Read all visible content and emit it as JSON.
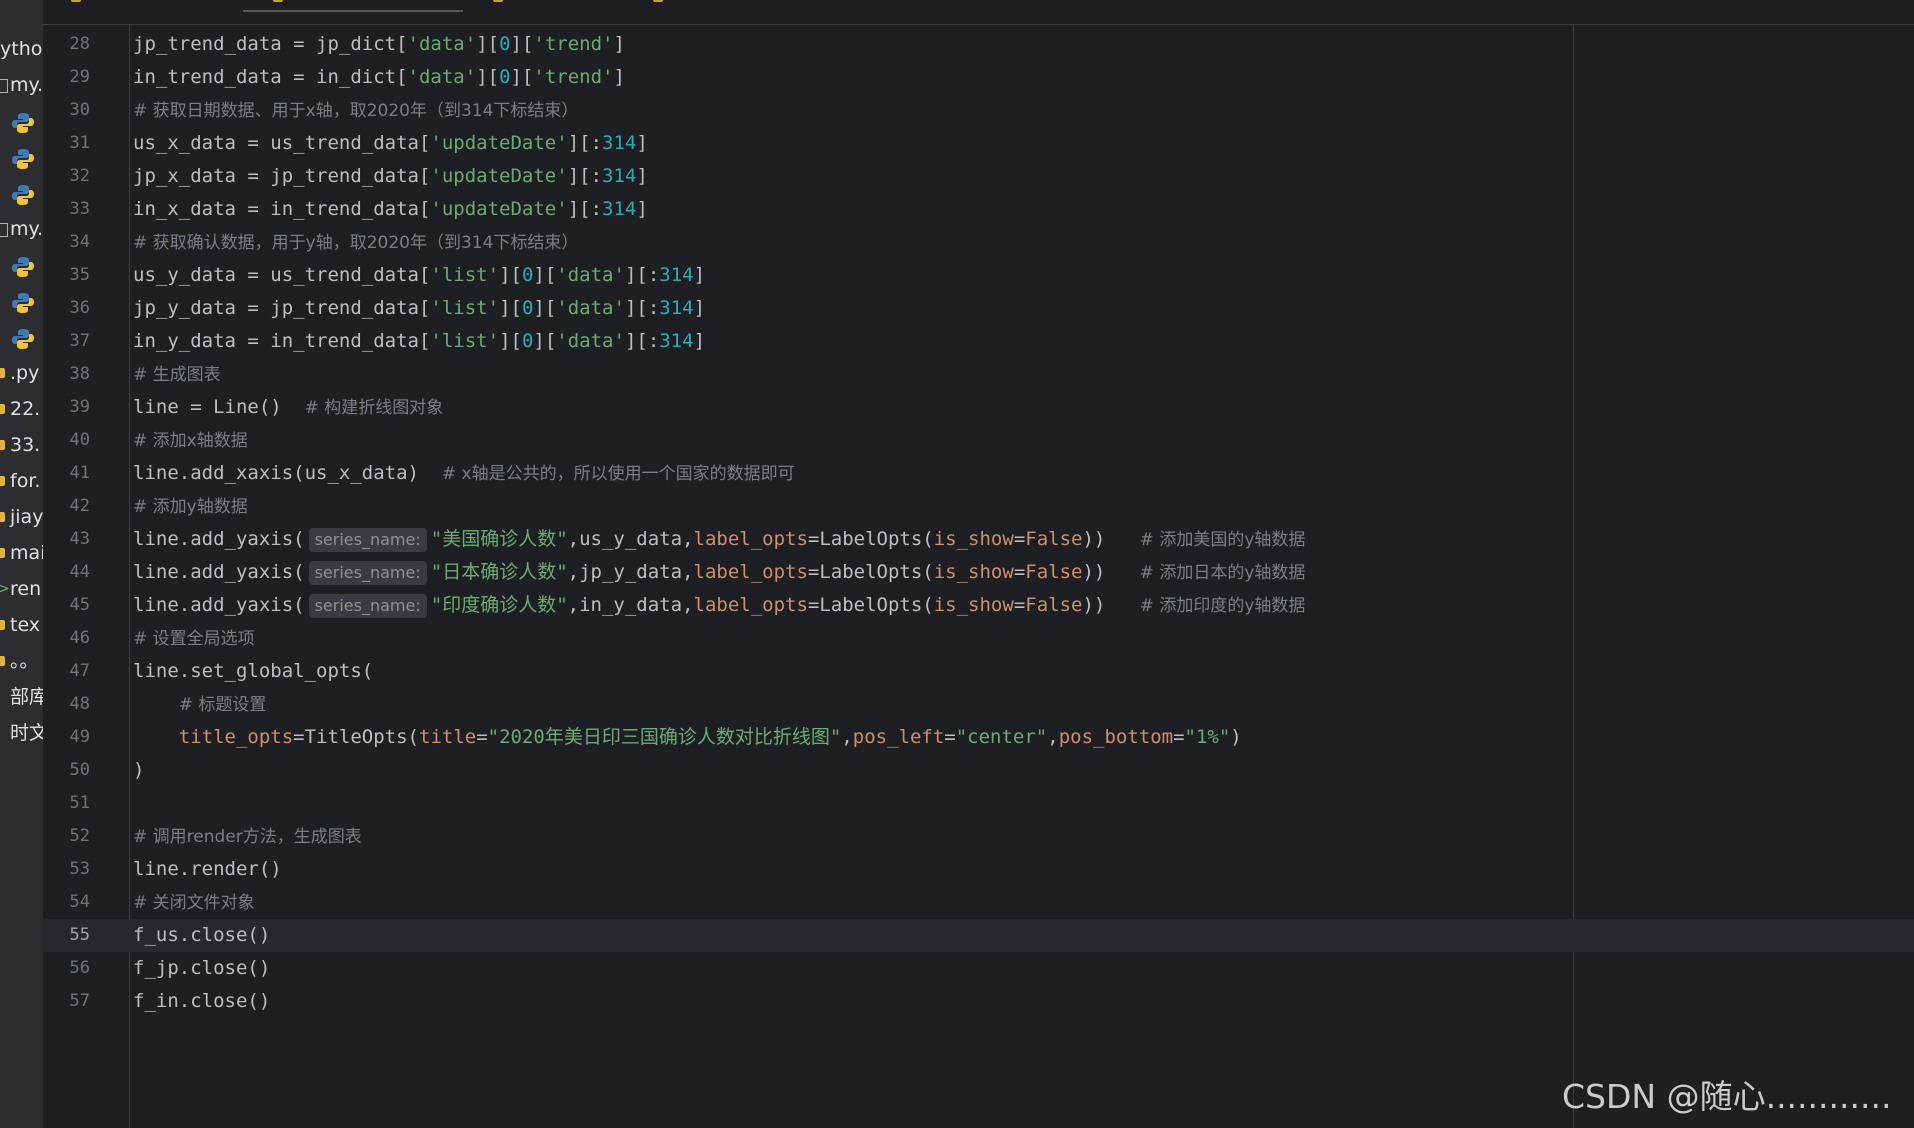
{
  "sidebar": {
    "header": "ytho",
    "items": [
      {
        "label": "my."
      },
      {
        "label": ""
      },
      {
        "label": ""
      },
      {
        "label": ""
      },
      {
        "label": "my."
      },
      {
        "label": ""
      },
      {
        "label": ""
      },
      {
        "label": ""
      },
      {
        "label": ".py"
      },
      {
        "label": "22."
      },
      {
        "label": "33."
      },
      {
        "label": "for."
      },
      {
        "label": "jiay"
      },
      {
        "label": "mai"
      },
      {
        "label": "ren"
      },
      {
        "label": "tex"
      },
      {
        "label": "。。"
      },
      {
        "label": "部库"
      },
      {
        "label": "时文"
      }
    ]
  },
  "editor": {
    "lines": [
      {
        "num": "28",
        "code": "jp_trend_data = jp_dict[",
        "s1": "'data'",
        "mid": "][",
        "n1": "0",
        "mid2": "][",
        "s2": "'trend'",
        "end": "]"
      },
      {
        "num": "29",
        "code": "in_trend_data = in_dict[",
        "s1": "'data'",
        "mid": "][",
        "n1": "0",
        "mid2": "][",
        "s2": "'trend'",
        "end": "]"
      },
      {
        "num": "30",
        "comment": "# 获取日期数据、用于x轴，取2020年（到314下标结束）"
      },
      {
        "num": "31",
        "code": "us_x_data = us_trend_data[",
        "s1": "'updateDate'",
        "mid": "][:",
        "n1": "314",
        "end": "]"
      },
      {
        "num": "32",
        "code": "jp_x_data = jp_trend_data[",
        "s1": "'updateDate'",
        "mid": "][:",
        "n1": "314",
        "end": "]"
      },
      {
        "num": "33",
        "code": "in_x_data = in_trend_data[",
        "s1": "'updateDate'",
        "mid": "][:",
        "n1": "314",
        "end": "]"
      },
      {
        "num": "34",
        "comment": "# 获取确认数据，用于y轴，取2020年（到314下标结束）"
      },
      {
        "num": "35",
        "code": "us_y_data = us_trend_data[",
        "s1": "'list'",
        "mid": "][",
        "n1": "0",
        "mid2": "][",
        "s2": "'data'",
        "mid3": "][:",
        "n2": "314",
        "end": "]"
      },
      {
        "num": "36",
        "code": "jp_y_data = jp_trend_data[",
        "s1": "'list'",
        "mid": "][",
        "n1": "0",
        "mid2": "][",
        "s2": "'data'",
        "mid3": "][:",
        "n2": "314",
        "end": "]"
      },
      {
        "num": "37",
        "code": "in_y_data = in_trend_data[",
        "s1": "'list'",
        "mid": "][",
        "n1": "0",
        "mid2": "][",
        "s2": "'data'",
        "mid3": "][:",
        "n2": "314",
        "end": "]"
      },
      {
        "num": "38",
        "comment": "# 生成图表"
      },
      {
        "num": "39",
        "code": "line = Line()  ",
        "tail_comment": "# 构建折线图对象"
      },
      {
        "num": "40",
        "comment": "# 添加x轴数据"
      },
      {
        "num": "41",
        "code": "line.add_xaxis(us_x_data)  ",
        "tail_comment": "# x轴是公共的，所以使用一个国家的数据即可"
      },
      {
        "num": "42",
        "comment": "# 添加y轴数据"
      },
      {
        "num": "43",
        "yaxis": true,
        "hint": "series_name:",
        "s1": "\"美国确诊人数\"",
        "var": "us_y_data",
        "tail_comment": "# 添加美国的y轴数据"
      },
      {
        "num": "44",
        "yaxis": true,
        "hint": "series_name:",
        "s1": "\"日本确诊人数\"",
        "var": "jp_y_data",
        "tail_comment": "# 添加日本的y轴数据"
      },
      {
        "num": "45",
        "yaxis": true,
        "hint": "series_name:",
        "s1": "\"印度确诊人数\"",
        "var": "in_y_data",
        "tail_comment": "# 添加印度的y轴数据"
      },
      {
        "num": "46",
        "comment": "# 设置全局选项"
      },
      {
        "num": "47",
        "code": "line.set_global_opts("
      },
      {
        "num": "48",
        "indent": true,
        "comment": "# 标题设置"
      },
      {
        "num": "49",
        "title": true,
        "title_text": "\"2020年美日印三国确诊人数对比折线图\"",
        "pos_left": "\"center\"",
        "pos_bottom": "\"1%\""
      },
      {
        "num": "50",
        "code": ")"
      },
      {
        "num": "51",
        "code": ""
      },
      {
        "num": "52",
        "comment": "# 调用render方法，生成图表"
      },
      {
        "num": "53",
        "code": "line.render()"
      },
      {
        "num": "54",
        "comment": "# 关闭文件对象"
      },
      {
        "num": "55",
        "code": "f_us.close()",
        "current": true
      },
      {
        "num": "56",
        "code": "f_jp.close()"
      },
      {
        "num": "57",
        "code": "f_in.close()"
      }
    ],
    "kw": {
      "label_opts": "label_opts",
      "is_show": "is_show",
      "false_val": "False",
      "labelopts_call": "LabelOpts(",
      "add_yaxis": "line.add_yaxis(",
      "title_opts": "title_opts",
      "titleopts_call": "TitleOpts(",
      "title_kw": "title",
      "pos_left_kw": "pos_left",
      "pos_bottom_kw": "pos_bottom"
    }
  },
  "watermark": "CSDN @随心............",
  "colors": {
    "background": "#1e1f22",
    "string": "#6aab73",
    "number": "#2aacb8",
    "param": "#cf8e6d",
    "comment": "#7a7e85"
  }
}
